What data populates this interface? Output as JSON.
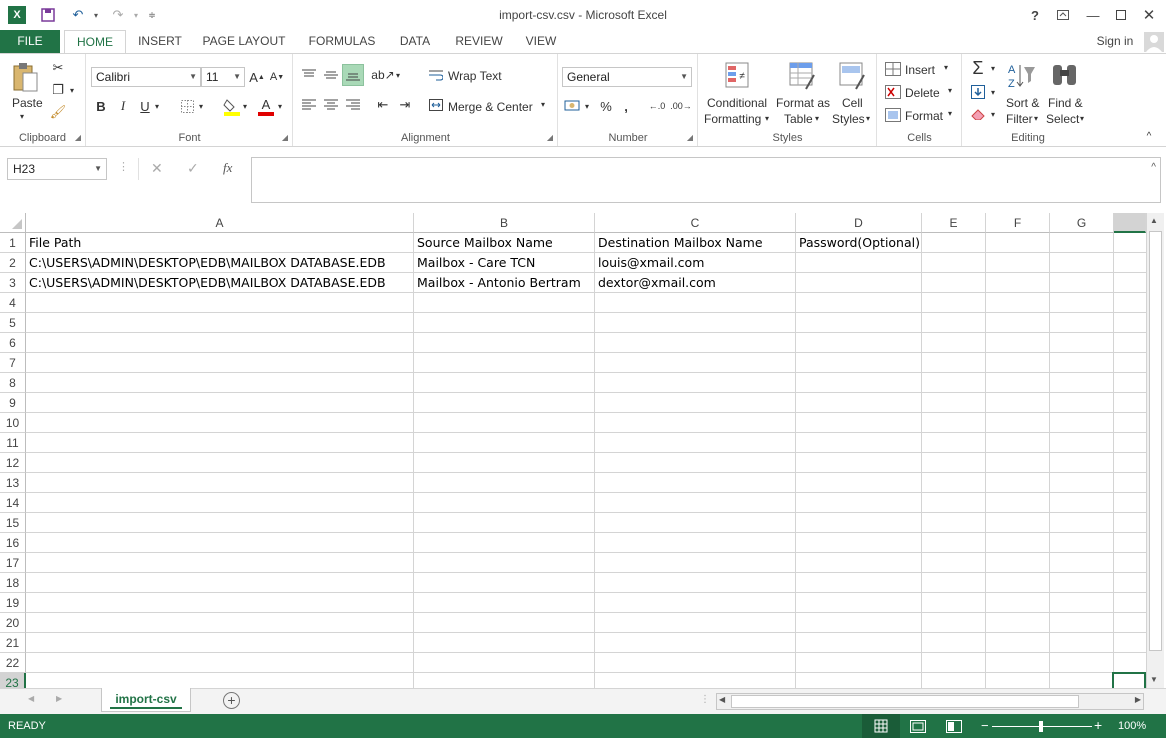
{
  "window": {
    "title": "import-csv.csv - Microsoft Excel",
    "sign_in": "Sign in"
  },
  "tabs": [
    "FILE",
    "HOME",
    "INSERT",
    "PAGE LAYOUT",
    "FORMULAS",
    "DATA",
    "REVIEW",
    "VIEW"
  ],
  "ribbon": {
    "clipboard": {
      "label": "Clipboard",
      "paste": "Paste"
    },
    "font": {
      "label": "Font",
      "name": "Calibri",
      "size": "11"
    },
    "alignment": {
      "label": "Alignment",
      "wrap_text": "Wrap Text",
      "merge_center": "Merge & Center"
    },
    "number": {
      "label": "Number",
      "format": "General"
    },
    "styles": {
      "label": "Styles",
      "conditional_1": "Conditional",
      "conditional_2": "Formatting",
      "format_table_1": "Format as",
      "format_table_2": "Table",
      "cell_styles_1": "Cell",
      "cell_styles_2": "Styles"
    },
    "cells": {
      "label": "Cells",
      "insert": "Insert",
      "delete": "Delete",
      "format": "Format"
    },
    "editing": {
      "label": "Editing",
      "sort_1": "Sort &",
      "sort_2": "Filter",
      "find_1": "Find &",
      "find_2": "Select"
    }
  },
  "formula_bar": {
    "name_box": "H23",
    "fx": "fx",
    "value": ""
  },
  "columns": [
    "A",
    "B",
    "C",
    "D",
    "E",
    "F",
    "G"
  ],
  "rows": [
    "1",
    "2",
    "3",
    "4",
    "5",
    "6",
    "7",
    "8",
    "9",
    "10",
    "11",
    "12",
    "13",
    "14",
    "15",
    "16",
    "17",
    "18",
    "19",
    "20",
    "21",
    "22",
    "23"
  ],
  "cells": [
    [
      "File Path",
      "Source Mailbox Name",
      "Destination Mailbox Name",
      "Password(Optional)"
    ],
    [
      "C:\\USERS\\ADMIN\\DESKTOP\\EDB\\MAILBOX DATABASE.EDB",
      "Mailbox - Care TCN",
      "louis@xmail.com",
      ""
    ],
    [
      "C:\\USERS\\ADMIN\\DESKTOP\\EDB\\MAILBOX DATABASE.EDB",
      "Mailbox - Antonio Bertram",
      "dextor@xmail.com",
      ""
    ]
  ],
  "sheet_tab": "import-csv",
  "status": {
    "mode": "READY",
    "zoom": "100%"
  },
  "colors": {
    "accent": "#217346"
  }
}
